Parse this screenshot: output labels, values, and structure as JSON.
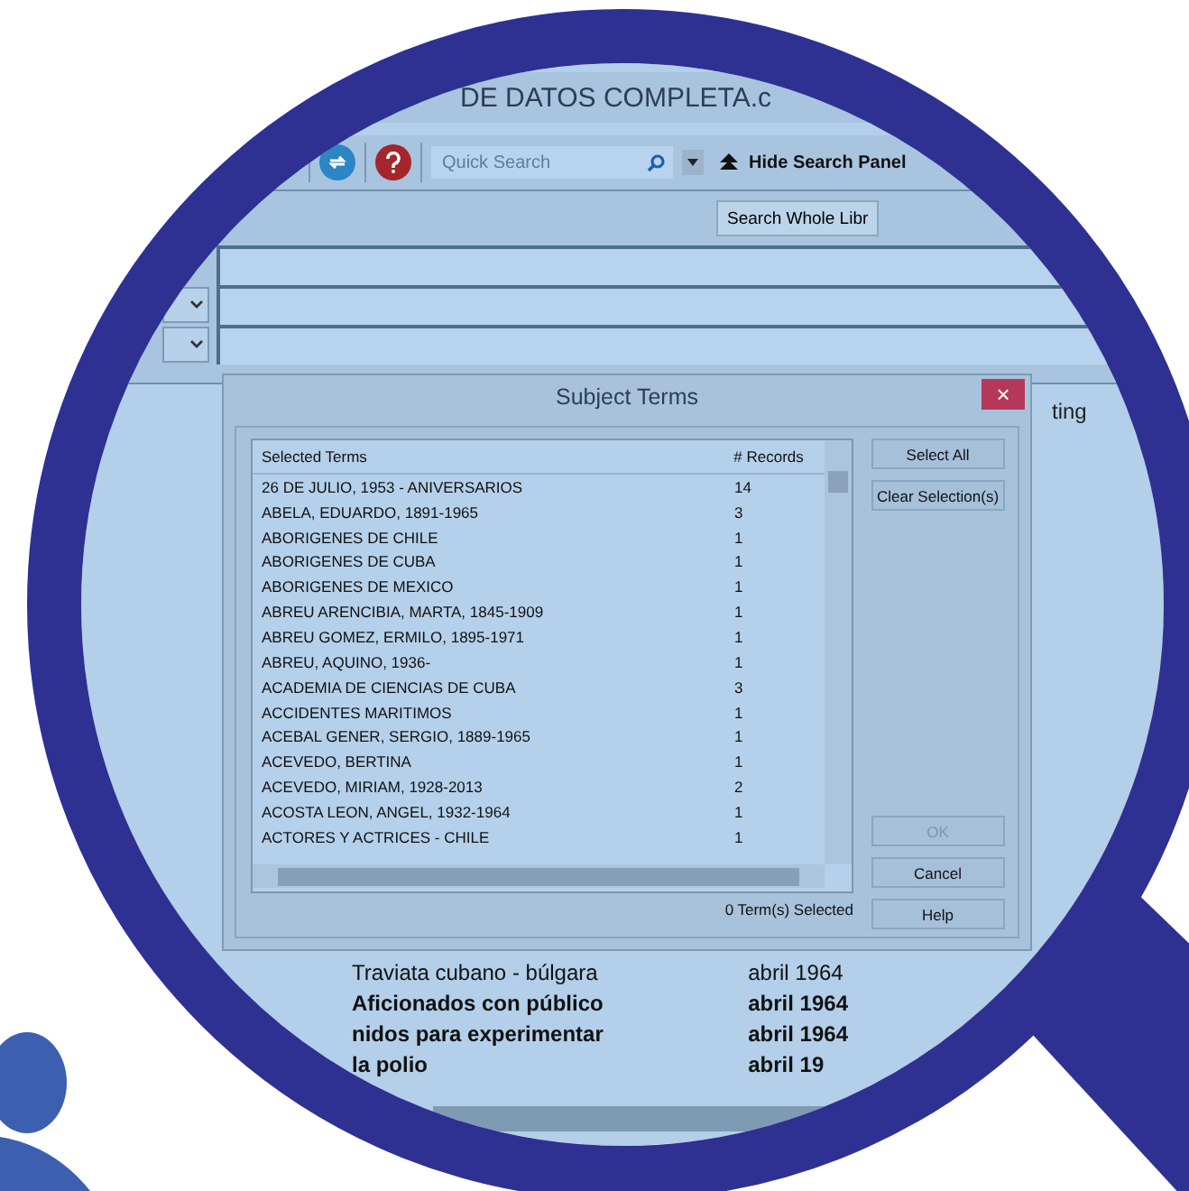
{
  "window": {
    "title": "DE DATOS COMPLETA.c"
  },
  "toolbar": {
    "quick_search": {
      "placeholder": "Quick Search"
    },
    "hide_panel": "Hide Search Panel"
  },
  "search_scope_button": "Search Whole Libr",
  "search_fields": [
    {
      "kind": "plain"
    },
    {
      "kind": "dropdown"
    },
    {
      "kind": "dropdown"
    }
  ],
  "background_tab": "ting",
  "dialog": {
    "title": "Subject Terms",
    "close": "×",
    "columns": [
      "Selected Terms",
      "# Records"
    ],
    "rows": [
      {
        "term": "26 DE JULIO, 1953 - ANIVERSARIOS",
        "records": "14"
      },
      {
        "term": "ABELA, EDUARDO, 1891-1965",
        "records": "3"
      },
      {
        "term": "ABORIGENES DE CHILE",
        "records": "1"
      },
      {
        "term": "ABORIGENES DE CUBA",
        "records": "1"
      },
      {
        "term": "ABORIGENES DE MEXICO",
        "records": "1"
      },
      {
        "term": "ABREU ARENCIBIA, MARTA, 1845-1909",
        "records": "1"
      },
      {
        "term": "ABREU GOMEZ, ERMILO, 1895-1971",
        "records": "1"
      },
      {
        "term": "ABREU, AQUINO, 1936-",
        "records": "1"
      },
      {
        "term": "ACADEMIA DE CIENCIAS DE CUBA",
        "records": "3"
      },
      {
        "term": "ACCIDENTES MARITIMOS",
        "records": "1"
      },
      {
        "term": "ACEBAL GENER, SERGIO, 1889-1965",
        "records": "1"
      },
      {
        "term": "ACEVEDO, BERTINA",
        "records": "1"
      },
      {
        "term": "ACEVEDO, MIRIAM, 1928-2013",
        "records": "2"
      },
      {
        "term": "ACOSTA LEON, ANGEL, 1932-1964",
        "records": "1"
      },
      {
        "term": "ACTORES Y ACTRICES - CHILE",
        "records": "1"
      }
    ],
    "status": "0 Term(s) Selected",
    "side_buttons": [
      {
        "label": "Select All",
        "disabled": false
      },
      {
        "label": "Clear Selection(s)",
        "disabled": false
      }
    ],
    "bottom_buttons": [
      {
        "label": "OK",
        "disabled": true
      },
      {
        "label": "Cancel",
        "disabled": false
      },
      {
        "label": "Help",
        "disabled": false
      }
    ]
  },
  "results": [
    {
      "title": "Traviata cubano - búlgara",
      "date": "abril 1964",
      "bold": false
    },
    {
      "title": "Aficionados con público",
      "date": "abril 1964",
      "bold": true
    },
    {
      "title": "nidos para experimentar",
      "date": "abril 1964",
      "bold": true
    },
    {
      "title": "la polio",
      "date": "abril 19",
      "bold": true
    }
  ]
}
